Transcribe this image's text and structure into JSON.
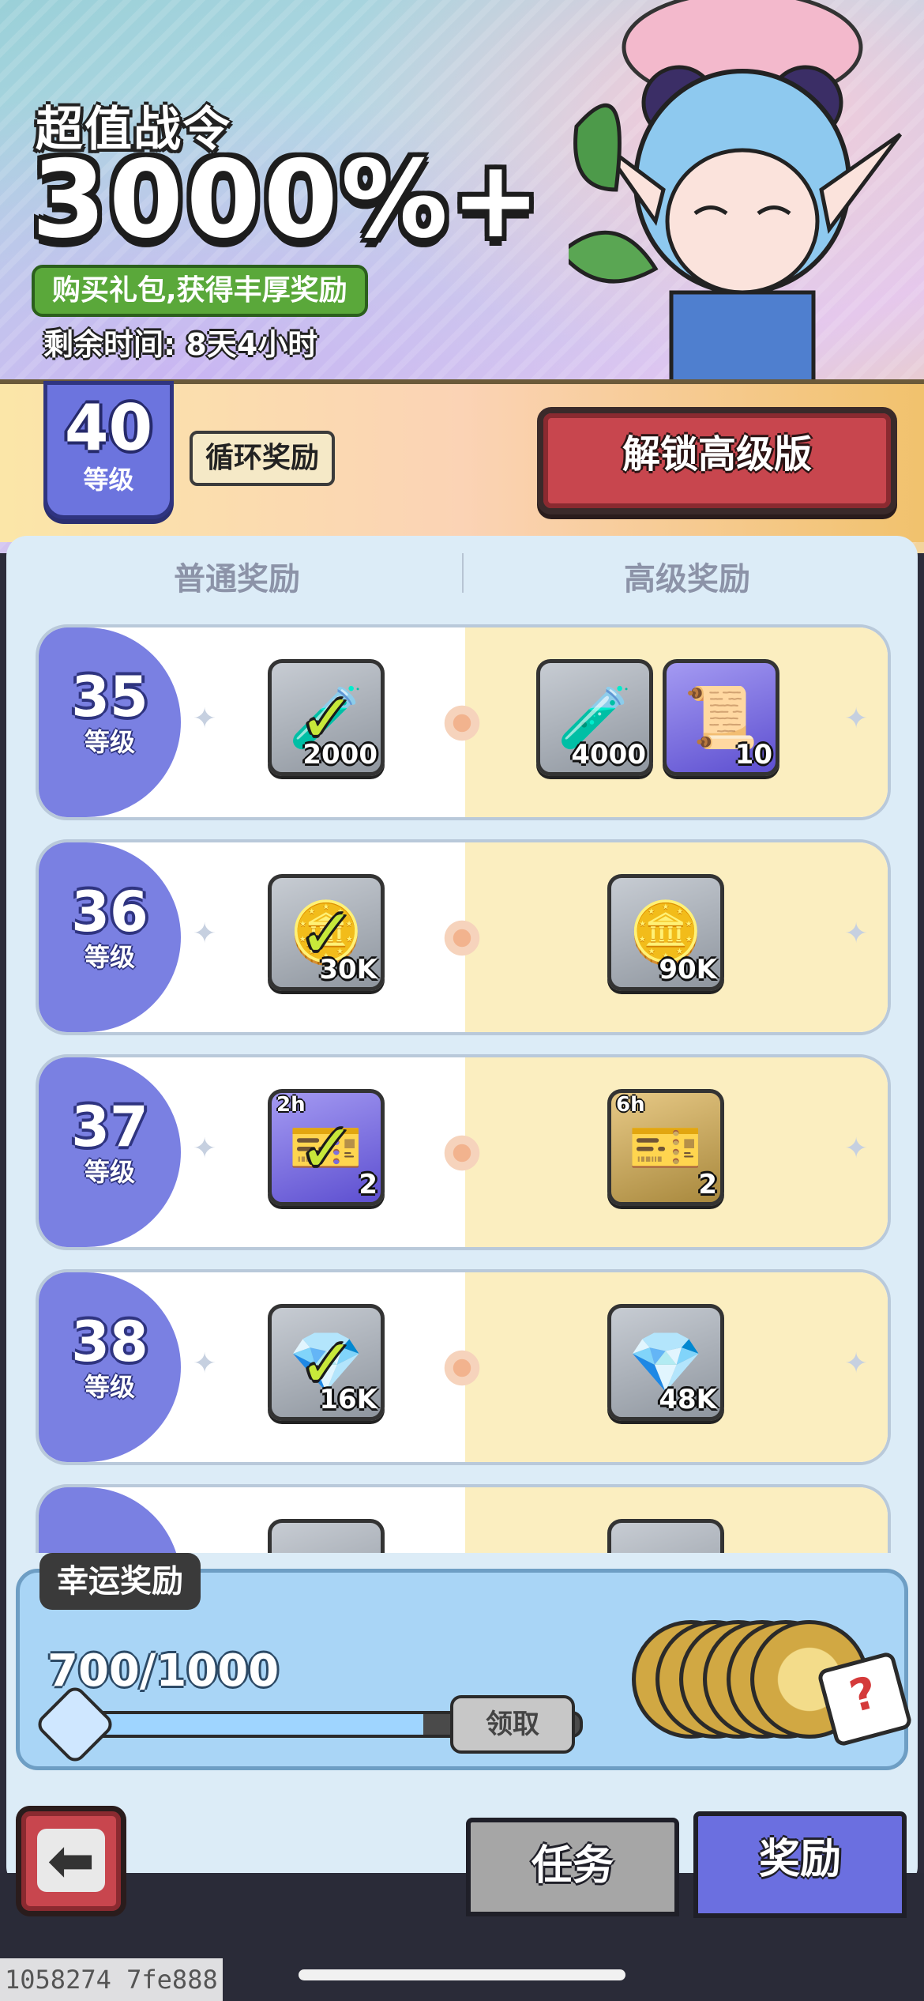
{
  "header": {
    "title_small": "超值战令",
    "title_big": "3000%+",
    "subtitle": "购买礼包,获得丰厚奖励",
    "timer": "剩余时间: 8天4小时"
  },
  "level_bar": {
    "current_level": "40",
    "level_label": "等级",
    "cycle_label": "循环奖励",
    "unlock_button": "解锁高级版"
  },
  "columns": {
    "normal": "普通奖励",
    "premium": "高级奖励"
  },
  "rows": [
    {
      "level": "35",
      "label": "等级",
      "normal": [
        {
          "icon": "purple-potion-icon",
          "qty": "2000",
          "claimed": true
        }
      ],
      "premium": [
        {
          "icon": "purple-potion-icon",
          "qty": "4000"
        },
        {
          "icon": "summon-scroll-icon",
          "qty": "10"
        }
      ]
    },
    {
      "level": "36",
      "label": "等级",
      "normal": [
        {
          "icon": "gold-coin-icon",
          "qty": "30K",
          "claimed": true
        }
      ],
      "premium": [
        {
          "icon": "gold-coin-icon",
          "qty": "90K"
        }
      ]
    },
    {
      "level": "37",
      "label": "等级",
      "normal": [
        {
          "icon": "time-potion-ticket-icon",
          "qty": "2",
          "tag": "2h",
          "claimed": true
        }
      ],
      "premium": [
        {
          "icon": "time-potion-ticket-icon",
          "qty": "2",
          "tag": "6h"
        }
      ]
    },
    {
      "level": "38",
      "label": "等级",
      "normal": [
        {
          "icon": "blue-crystal-icon",
          "qty": "16K",
          "claimed": true
        }
      ],
      "premium": [
        {
          "icon": "blue-crystal-icon",
          "qty": "48K"
        }
      ]
    }
  ],
  "lucky": {
    "title": "幸运奖励",
    "count": "700/1000",
    "progress": 0.7,
    "claim_button": "领取",
    "reward_icon": "lucky-coins-dice-icon"
  },
  "nav": {
    "back_icon": "back-arrow-icon",
    "tab_task": "任务",
    "tab_reward": "奖励"
  },
  "build_id": "1058274 7fe888",
  "colors": {
    "accent_purple": "#6b6fe0",
    "unlock_red": "#c8464e",
    "check_green": "#c7e83a",
    "premium_bg": "#fbeec0"
  }
}
